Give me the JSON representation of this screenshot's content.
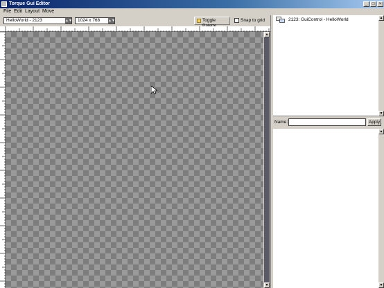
{
  "window": {
    "title": "Torque Gui Editor",
    "minimize_glyph": "_",
    "maximize_glyph": "□",
    "close_glyph": "×"
  },
  "menu": [
    "File",
    "Edit",
    "Layout",
    "Move"
  ],
  "toolbar": {
    "control_select": "HelloWorld - 2123",
    "resolution_select": "1024 x 768",
    "toggle_palette": "Toggle Palette",
    "snap_to_grid": "Snap to grid"
  },
  "tree": {
    "item_label": "2123: GuiControl - HelloWorld"
  },
  "inspector": {
    "name_label": "Name:",
    "name_value": "",
    "apply_label": "Apply"
  },
  "icons": {
    "dropdown_arrow": "▲▼",
    "scroll_up": "▲",
    "scroll_down": "▼",
    "cursor": "mouse-pointer"
  },
  "colors": {
    "title_bar": "#0a246a",
    "canvas_light": "#9a9a9a",
    "canvas_dark": "#7d7d7d"
  }
}
